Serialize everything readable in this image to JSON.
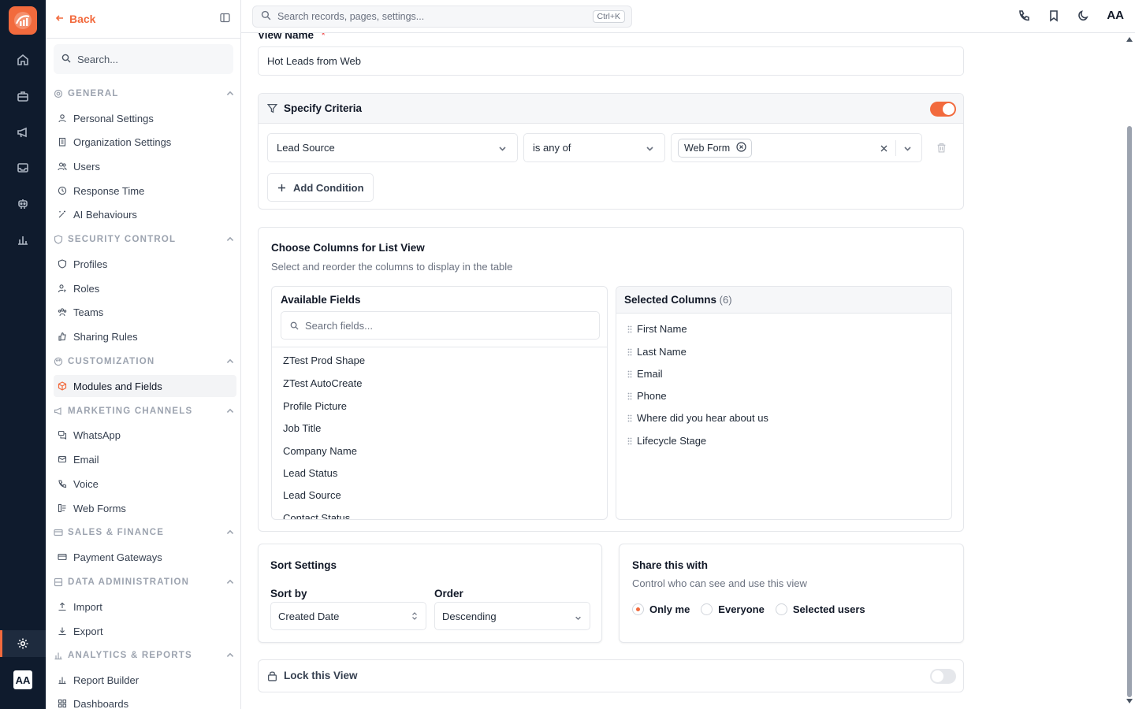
{
  "rail": {
    "icons": [
      "home-icon",
      "briefcase-icon",
      "megaphone-icon",
      "inbox-icon",
      "robot-icon",
      "chart-icon"
    ],
    "active": "settings-icon",
    "avatar": "AA"
  },
  "sidebar": {
    "back_label": "Back",
    "search_placeholder": "Search...",
    "sections": [
      {
        "title": "GENERAL",
        "items": [
          "Personal Settings",
          "Organization Settings",
          "Users",
          "Response Time",
          "AI Behaviours"
        ]
      },
      {
        "title": "SECURITY CONTROL",
        "items": [
          "Profiles",
          "Roles",
          "Teams",
          "Sharing Rules"
        ]
      },
      {
        "title": "CUSTOMIZATION",
        "items": [
          "Modules and Fields"
        ]
      },
      {
        "title": "MARKETING CHANNELS",
        "items": [
          "WhatsApp",
          "Email",
          "Voice",
          "Web Forms"
        ]
      },
      {
        "title": "SALES & FINANCE",
        "items": [
          "Payment Gateways"
        ]
      },
      {
        "title": "DATA ADMINISTRATION",
        "items": [
          "Import",
          "Export"
        ]
      },
      {
        "title": "ANALYTICS & REPORTS",
        "items": [
          "Report Builder",
          "Dashboards"
        ]
      }
    ],
    "active_item": "Modules and Fields"
  },
  "topbar": {
    "search_placeholder": "Search records, pages, settings...",
    "shortcut": "Ctrl+K",
    "avatar": "AA"
  },
  "form": {
    "view_name_label": "View Name",
    "required_mark": "*",
    "view_name_value": "Hot Leads from Web",
    "criteria": {
      "title": "Specify Criteria",
      "enabled": true,
      "field": "Lead Source",
      "operator": "is any of",
      "value_chip": "Web Form",
      "add_condition": "Add Condition"
    },
    "columns": {
      "title": "Choose Columns for List View",
      "subtitle": "Select and reorder the columns to display in the table",
      "available_title": "Available Fields",
      "available_search_placeholder": "Search fields...",
      "available_fields": [
        "ZTest Prod Shape",
        "ZTest AutoCreate",
        "Profile Picture",
        "Job Title",
        "Company Name",
        "Lead Status",
        "Lead Source",
        "Contact Status"
      ],
      "selected_title": "Selected Columns",
      "selected_count": "(6)",
      "selected_fields": [
        "First Name",
        "Last Name",
        "Email",
        "Phone",
        "Where did you hear about us",
        "Lifecycle Stage"
      ]
    },
    "sort": {
      "title": "Sort Settings",
      "sort_by_label": "Sort by",
      "sort_by_value": "Created Date",
      "order_label": "Order",
      "order_value": "Descending"
    },
    "share": {
      "title": "Share this with",
      "subtitle": "Control who can see and use this view",
      "options": [
        "Only me",
        "Everyone",
        "Selected users"
      ],
      "selected": "Only me"
    },
    "lock": {
      "label": "Lock this View",
      "enabled": false
    }
  },
  "colors": {
    "accent": "#f26a3d",
    "rail_bg": "#0f1b2d"
  }
}
